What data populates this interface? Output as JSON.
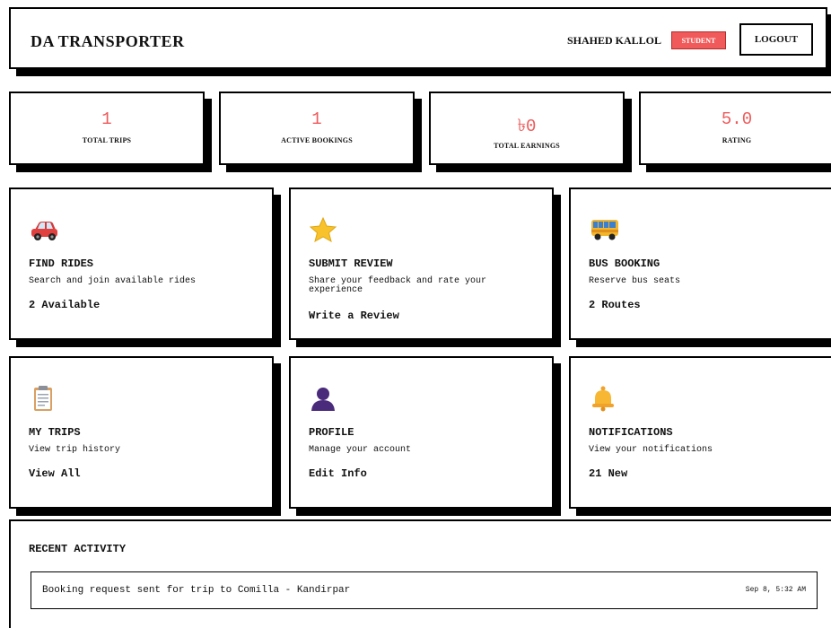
{
  "header": {
    "brand": "DA TRANSPORTER",
    "user_name": "SHAHED KALLOL",
    "role_badge": "STUDENT",
    "logout_label": "LOGOUT"
  },
  "colors": {
    "accent": "#ef5a5a",
    "border": "#000000"
  },
  "stats": [
    {
      "value": "1",
      "label": "TOTAL TRIPS"
    },
    {
      "value": "1",
      "label": "ACTIVE BOOKINGS"
    },
    {
      "value": "৳0",
      "label": "TOTAL EARNINGS"
    },
    {
      "value": "5.0",
      "label": "RATING"
    }
  ],
  "cards": [
    {
      "icon": "car-icon",
      "title": "FIND RIDES",
      "desc": "Search and join available rides",
      "stat": "2 Available"
    },
    {
      "icon": "star-icon",
      "title": "SUBMIT REVIEW",
      "desc": "Share your feedback and rate your experience",
      "stat": "Write a Review"
    },
    {
      "icon": "bus-icon",
      "title": "BUS BOOKING",
      "desc": "Reserve bus seats",
      "stat": "2 Routes"
    },
    {
      "icon": "clipboard-icon",
      "title": "MY TRIPS",
      "desc": "View trip history",
      "stat": "View All"
    },
    {
      "icon": "user-icon",
      "title": "PROFILE",
      "desc": "Manage your account",
      "stat": "Edit Info"
    },
    {
      "icon": "bell-icon",
      "title": "NOTIFICATIONS",
      "desc": "View your notifications",
      "stat": "21 New"
    }
  ],
  "activity": {
    "title": "RECENT ACTIVITY",
    "items": [
      {
        "text": "Booking request sent for trip to Comilla - Kandirpar",
        "time": "Sep 8, 5:32 AM"
      }
    ]
  }
}
